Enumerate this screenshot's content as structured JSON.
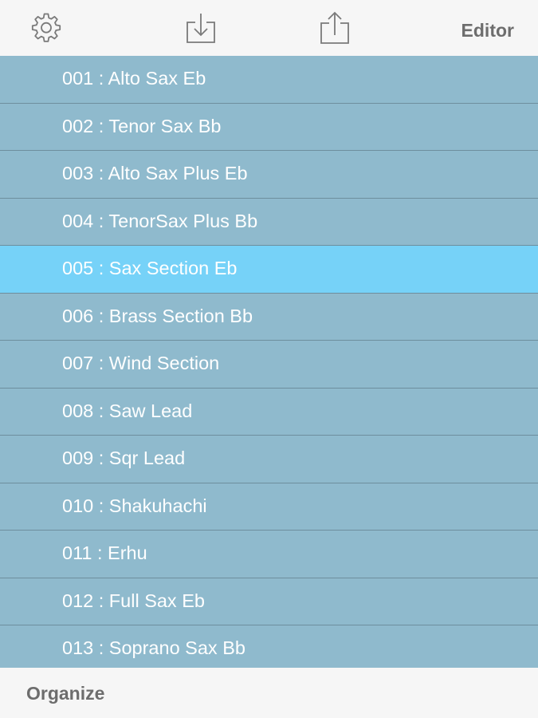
{
  "toolbar": {
    "editor_label": "Editor",
    "icons": [
      "gear-icon",
      "download-icon",
      "share-icon"
    ],
    "icon_color": "#7a7a7a"
  },
  "list": {
    "selected_index": 4,
    "items": [
      {
        "label": "001 : Alto Sax Eb"
      },
      {
        "label": "002 : Tenor Sax Bb"
      },
      {
        "label": "003 : Alto Sax Plus Eb"
      },
      {
        "label": "004 : TenorSax Plus Bb"
      },
      {
        "label": "005 : Sax Section Eb"
      },
      {
        "label": "006 : Brass Section Bb"
      },
      {
        "label": "007 : Wind Section"
      },
      {
        "label": "008 : Saw Lead"
      },
      {
        "label": "009 : Sqr Lead"
      },
      {
        "label": "010 : Shakuhachi"
      },
      {
        "label": "011 : Erhu"
      },
      {
        "label": "012 : Full Sax Eb"
      },
      {
        "label": "013 : Soprano Sax Bb"
      }
    ]
  },
  "bottombar": {
    "organize_label": "Organize"
  },
  "colors": {
    "row_background": "#8fbacd",
    "row_selected": "#76d2f8",
    "row_separator": "#6e8e9d",
    "row_text": "#ffffff",
    "bar_background": "#f6f6f6",
    "bar_text": "#6d6d6d"
  }
}
